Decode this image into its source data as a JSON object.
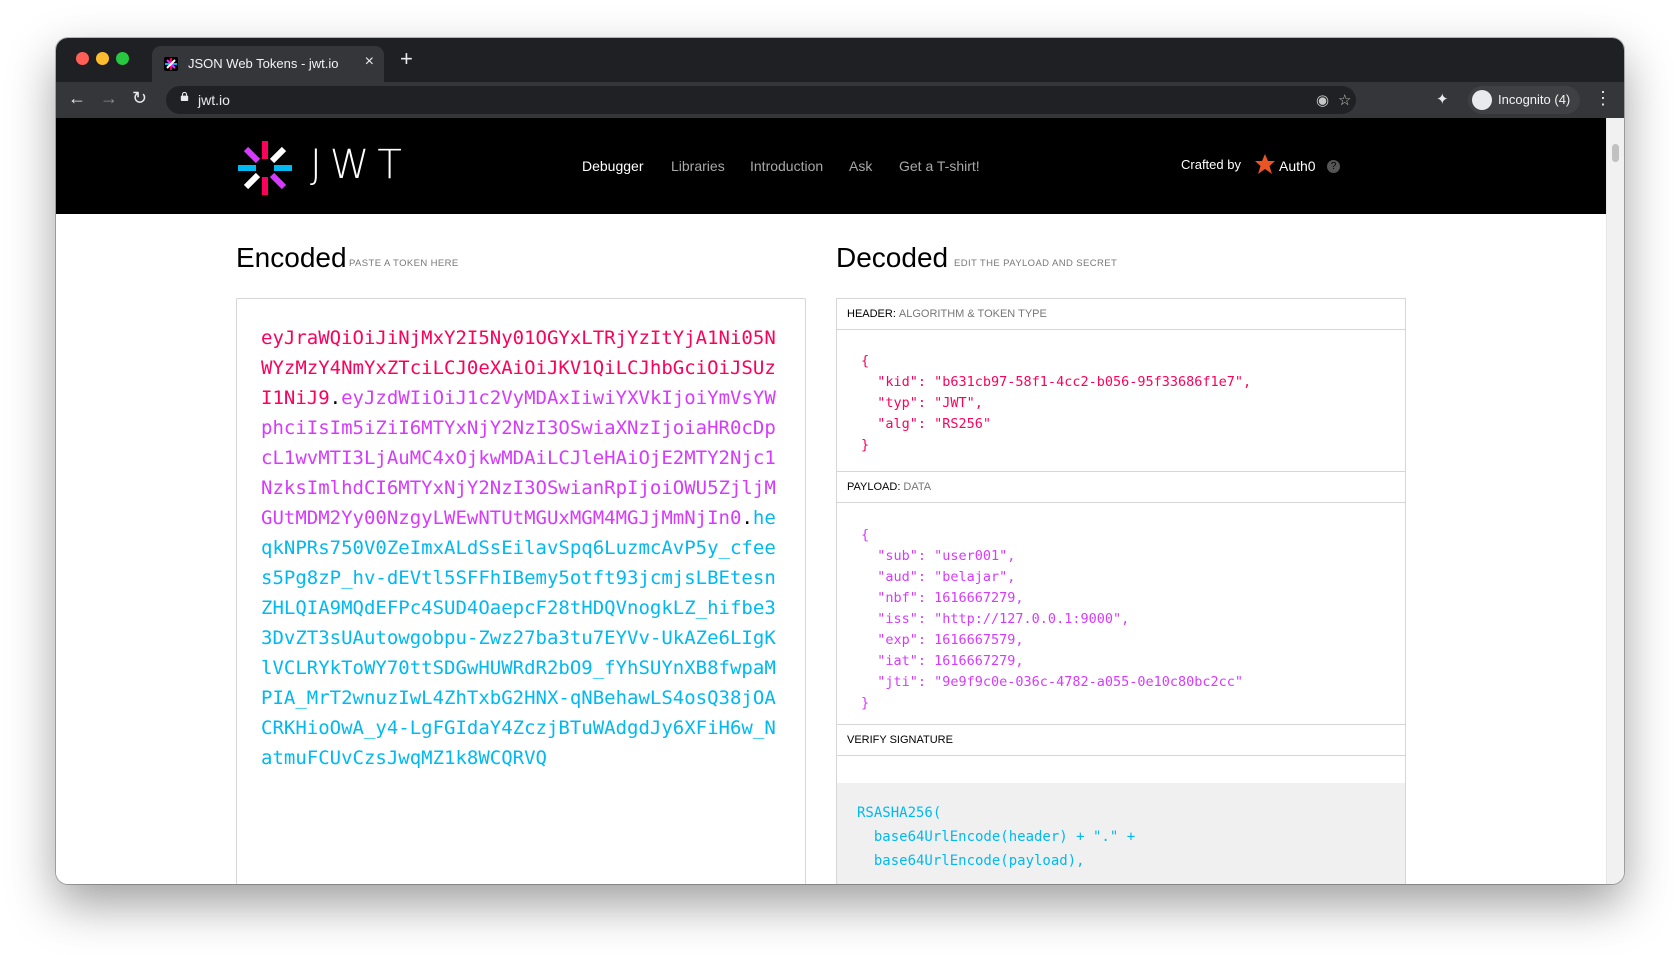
{
  "browser": {
    "tab_title": "JSON Web Tokens - jwt.io",
    "tab_close": "×",
    "new_tab": "+",
    "url": "jwt.io",
    "profile_label": "Incognito (4)"
  },
  "site": {
    "logo_text": "JWT",
    "nav": [
      "Debugger",
      "Libraries",
      "Introduction",
      "Ask",
      "Get a T-shirt!"
    ],
    "crafted_by": "Crafted by",
    "auth0": "Auth0",
    "help": "?"
  },
  "encoded": {
    "title": "Encoded",
    "subtitle": "PASTE A TOKEN HERE",
    "header_part": "eyJraWQiOiJiNjMxY2I5Ny01OGYxLTRjYzItYjA1Ni05NWYzMzY4NmYxZTciLCJ0eXAiOiJKV1QiLCJhbGciOiJSUzI1NiJ9",
    "dot1": ".",
    "payload_part": "eyJzdWIiOiJ1c2VyMDAxIiwiYXVkIjoiYmVsYWphciIsIm5iZiI6MTYxNjY2NzI3OSwiaXNzIjoiaHR0cDpcL1wvMTI3LjAuMC4xOjkwMDAiLCJleHAiOjE2MTY2Njc1NzksImlhdCI6MTYxNjY2NzI3OSwianRpIjoiOWU5ZjljMGUtMDM2Yy00NzgyLWEwNTUtMGUxMGM4MGJjMmNjIn0",
    "dot2": ".",
    "signature_part": "heqkNPRs750V0ZeImxALdSsEilavSpq6LuzmcAvP5y_cfees5Pg8zP_hv-dEVtl5SFFhIBemy5otft93jcmjsLBEtesnZHLQIA9MQdEFPc4SUD4OaepcF28tHDQVnogkLZ_hifbe33DvZT3sUAutowgobpu-Zwz27ba3tu7EYVv-UkAZe6LIgKlVCLRYkToWY70ttSDGwHUWRdR2bO9_fYhSUYnXB8fwpaMPIA_MrT2wnuzIwL4ZhTxbG2HNX-qNBehawLS4osQ38jOACRKHioOwA_y4-LgFGIdaY4ZczjBTuWAdgdJy6XFiH6w_NatmuFCUvCzsJwqMZ1k8WCQRVQ"
  },
  "decoded": {
    "title": "Decoded",
    "subtitle": "EDIT THE PAYLOAD AND SECRET",
    "header_label": "HEADER:",
    "header_desc": "ALGORITHM & TOKEN TYPE",
    "header_json": "{\n  \"kid\": \"b631cb97-58f1-4cc2-b056-95f33686f1e7\",\n  \"typ\": \"JWT\",\n  \"alg\": \"RS256\"\n}",
    "payload_label": "PAYLOAD:",
    "payload_desc": "DATA",
    "payload_json": "{\n  \"sub\": \"user001\",\n  \"aud\": \"belajar\",\n  \"nbf\": 1616667279,\n  \"iss\": \"http://127.0.0.1:9000\",\n  \"exp\": 1616667579,\n  \"iat\": 1616667279,\n  \"jti\": \"9e9f9c0e-036c-4782-a055-0e10c80bc2cc\"\n}",
    "verify_label": "VERIFY SIGNATURE",
    "verify_lines": [
      "RSASHA256(",
      "  base64UrlEncode(header) + \".\" +",
      "  base64UrlEncode(payload),"
    ]
  },
  "colors": {
    "header": "#fb015b",
    "payload": "#d63aff",
    "signature": "#00b9f1"
  }
}
